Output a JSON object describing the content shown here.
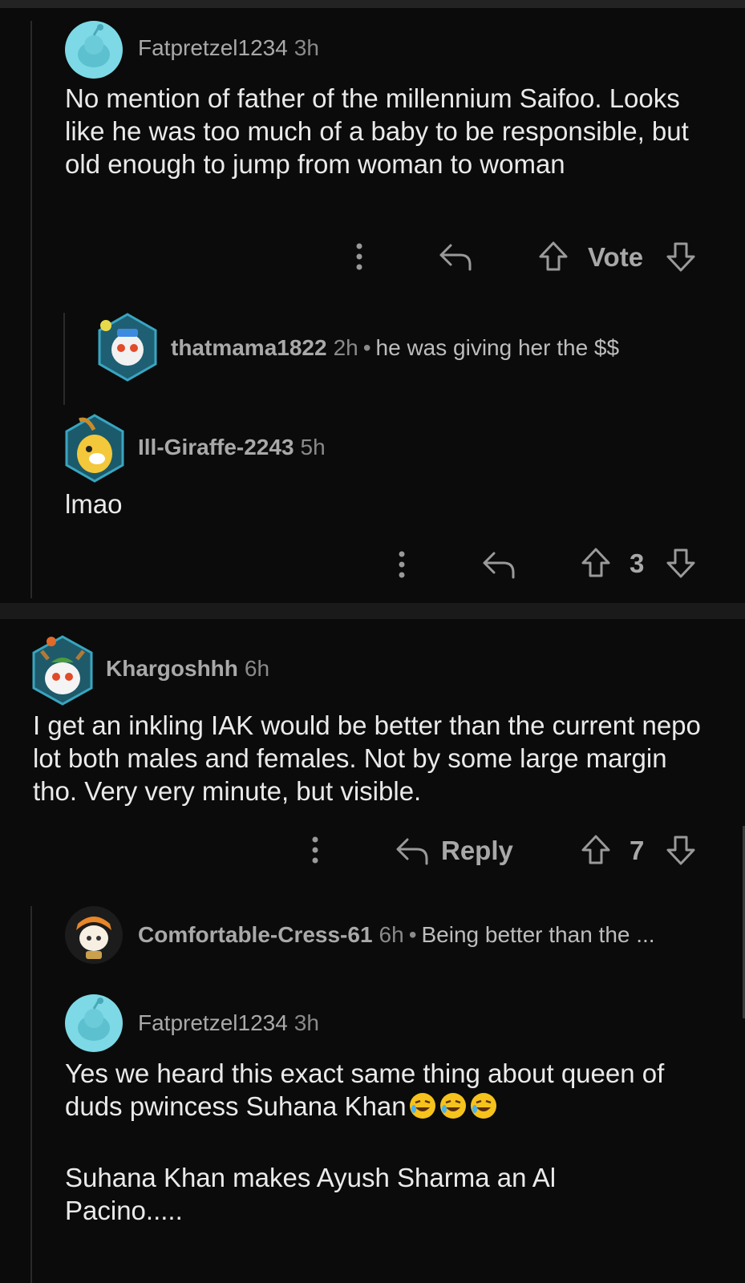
{
  "comments": [
    {
      "username": "Fatpretzel1234",
      "time": "3h",
      "body": "No mention of father of the millennium Saifoo. Looks like he was too much of a baby to be responsible, but old enough to jump from woman to woman",
      "vote_label": "Vote"
    },
    {
      "username": "thatmama1822",
      "time": "2h",
      "preview": "he was giving her the $$"
    },
    {
      "username": "Ill-Giraffe-2243",
      "time": "5h",
      "body": "lmao",
      "score": "3"
    },
    {
      "username": "Khargoshhh",
      "time": "6h",
      "body": "I get an inkling IAK would be better than the current nepo lot both males and females. Not by some large margin tho. Very very minute, but visible.",
      "reply_label": "Reply",
      "score": "7"
    },
    {
      "username": "Comfortable-Cress-61",
      "time": "6h",
      "preview": "Being better than the ..."
    },
    {
      "username": "Fatpretzel1234",
      "time": "3h",
      "body_line1": "Yes we heard this exact same thing about queen of duds pwincess Suhana Khan",
      "body_line2": "Suhana Khan makes Ayush Sharma an Al Pacino....."
    }
  ],
  "icons": {
    "more": "more-vertical-icon",
    "reply": "reply-arrow-icon",
    "upvote": "upvote-arrow-icon",
    "downvote": "downvote-arrow-icon",
    "emoji": "rolling-laughing-emoji"
  },
  "colors": {
    "background": "#0b0b0b",
    "text": "#eaeaea",
    "muted": "#a9a9a9",
    "avatar_teal": "#7dd9e6"
  }
}
